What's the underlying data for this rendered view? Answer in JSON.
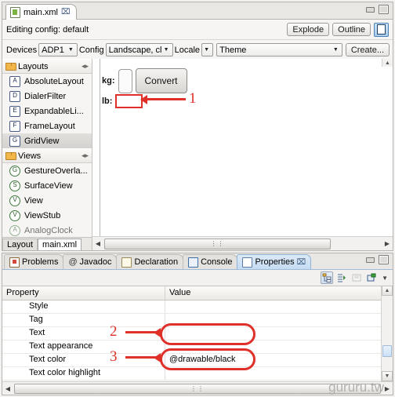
{
  "editor": {
    "tab": {
      "title": "main.xml",
      "icon": "xml-file-icon",
      "close": "⌧"
    },
    "window_buttons": {
      "minimize": "minimize-icon",
      "maximize": "maximize-icon"
    },
    "config_row": {
      "label": "Editing config:  default",
      "explode": "Explode",
      "outline": "Outline",
      "device_toggle": "device-view-icon"
    },
    "device_row": {
      "devices_label": "Devices",
      "devices_value": "ADP1",
      "config_label": "Config",
      "config_value": "Landscape, cl",
      "locale_label": "Locale",
      "theme_value": "Theme",
      "create_label": "Create..."
    }
  },
  "palette": {
    "groups": [
      {
        "name": "Layouts",
        "collapse_icon": "collapse-icon",
        "items": [
          {
            "badge": "A",
            "label": "AbsoluteLayout",
            "shape": "square",
            "selected": false
          },
          {
            "badge": "D",
            "label": "DialerFilter",
            "shape": "square",
            "selected": false
          },
          {
            "badge": "E",
            "label": "ExpandableLi...",
            "shape": "square",
            "selected": false
          },
          {
            "badge": "F",
            "label": "FrameLayout",
            "shape": "square",
            "selected": false
          },
          {
            "badge": "G",
            "label": "GridView",
            "shape": "square",
            "selected": true
          }
        ]
      },
      {
        "name": "Views",
        "collapse_icon": "collapse-icon",
        "items": [
          {
            "badge": "G",
            "label": "GestureOverla...",
            "shape": "round",
            "selected": false
          },
          {
            "badge": "S",
            "label": "SurfaceView",
            "shape": "round",
            "selected": false
          },
          {
            "badge": "V",
            "label": "View",
            "shape": "round",
            "selected": false
          },
          {
            "badge": "V",
            "label": "ViewStub",
            "shape": "round",
            "selected": false
          },
          {
            "badge": "A",
            "label": "AnalogClock",
            "shape": "round",
            "selected": false
          }
        ]
      }
    ],
    "bottom_tabs": [
      {
        "label": "Layout",
        "active": false
      },
      {
        "label": "main.xml",
        "active": true
      }
    ]
  },
  "canvas": {
    "kg_label": "kg:",
    "kg_value": "",
    "convert_label": "Convert",
    "lb_label": "lb:",
    "lb_value": "",
    "hscroll_grip": "⋮⋮"
  },
  "bottom_view": {
    "tabs": [
      {
        "label": "Problems",
        "icon": "problems-icon",
        "active": false
      },
      {
        "label": "Javadoc",
        "icon": "javadoc-icon",
        "active": false
      },
      {
        "label": "Declaration",
        "icon": "declaration-icon",
        "active": false
      },
      {
        "label": "Console",
        "icon": "console-icon",
        "active": false
      },
      {
        "label": "Properties",
        "icon": "properties-icon",
        "active": true
      }
    ],
    "tab_close": "⌧",
    "window_buttons": {
      "minimize": "minimize-icon",
      "maximize": "maximize-icon"
    },
    "toolbar": [
      {
        "name": "show-categories-icon",
        "pressed": true
      },
      {
        "name": "sort-alphabetically-icon",
        "pressed": false
      },
      {
        "name": "restore-default-icon",
        "pressed": false
      },
      {
        "name": "new-property-icon",
        "pressed": false
      }
    ],
    "toolbar_menu": "view-menu-chevron",
    "table": {
      "columns": [
        "Property",
        "Value"
      ],
      "rows": [
        {
          "property": "Style",
          "value": ""
        },
        {
          "property": "Tag",
          "value": ""
        },
        {
          "property": "Text",
          "value": ""
        },
        {
          "property": "Text appearance",
          "value": ""
        },
        {
          "property": "Text color",
          "value": "@drawable/black"
        },
        {
          "property": "Text color highlight",
          "value": ""
        }
      ]
    },
    "hscroll_grip": "⋮⋮"
  },
  "annotations": [
    {
      "number": "1",
      "target": "lb-field"
    },
    {
      "number": "2",
      "target": "text-property-value"
    },
    {
      "number": "3",
      "target": "text-color-property-value"
    }
  ],
  "watermark": "gururu.tw",
  "colors": {
    "accent_red": "#e0302a",
    "active_tab_blue": "#c5dcf2",
    "chrome": "#f6f5f3"
  }
}
